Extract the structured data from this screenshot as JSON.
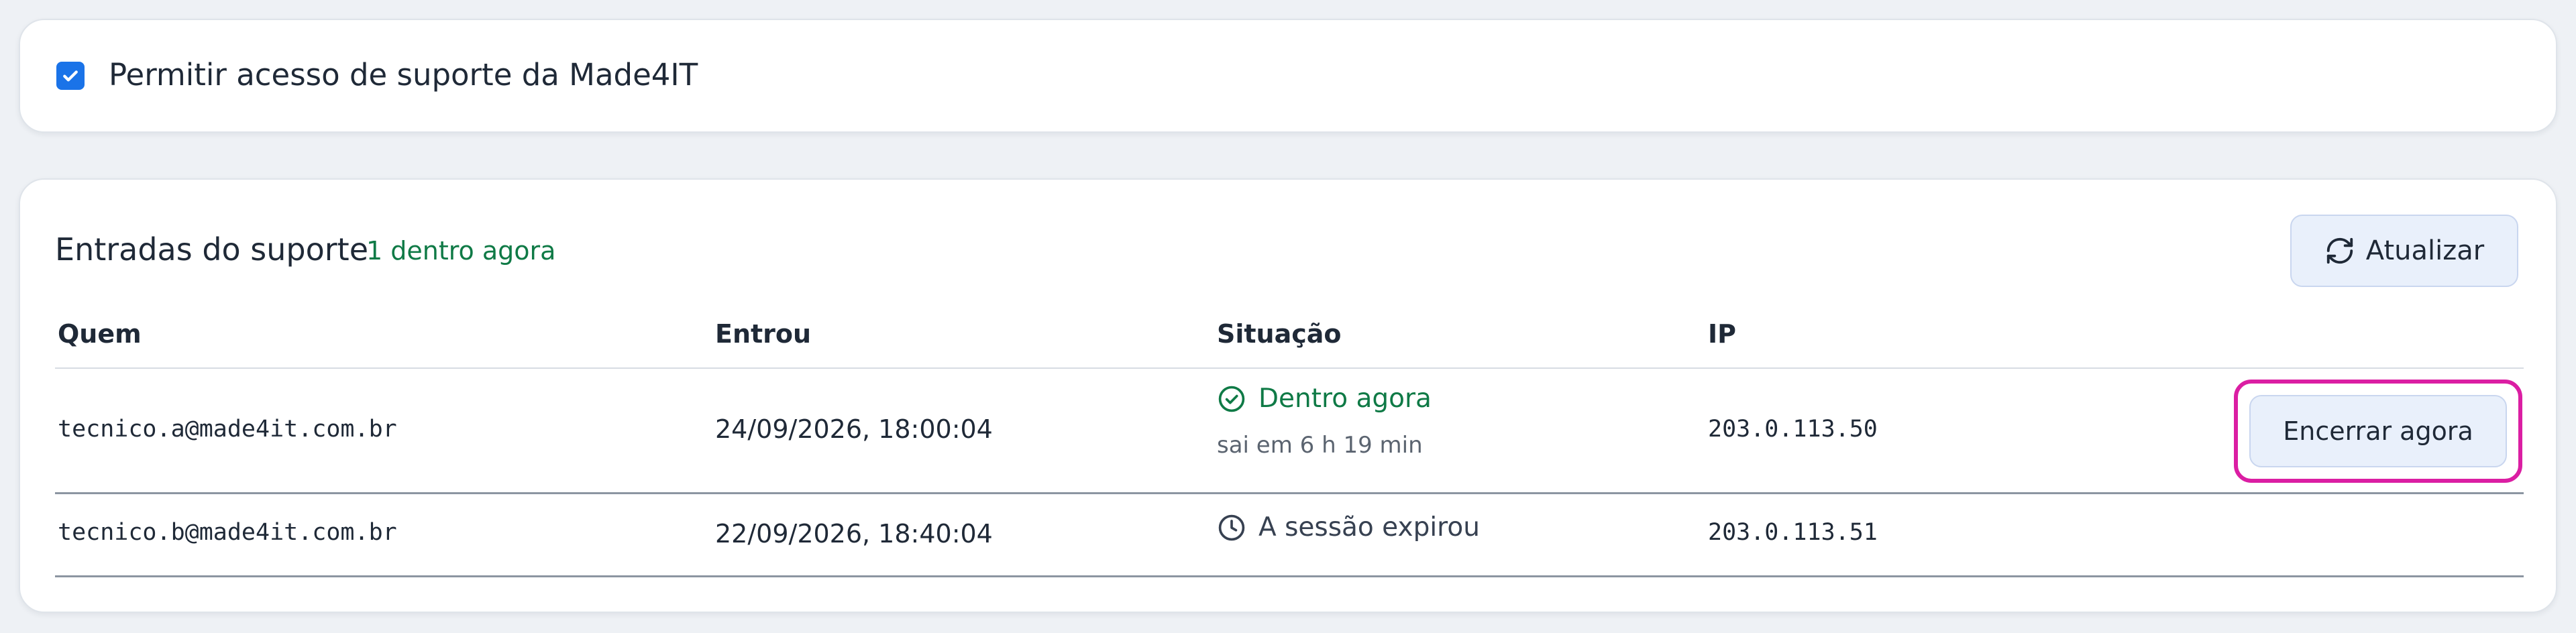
{
  "support_access": {
    "checkbox_checked": true,
    "label": "Permitir acesso de suporte da Made4IT"
  },
  "entries": {
    "title": "Entradas do suporte",
    "count_label": "1 dentro agora",
    "refresh_label": "Atualizar",
    "columns": [
      "Quem",
      "Entrou",
      "Situação",
      "IP"
    ],
    "rows": [
      {
        "who": "tecnico.a@made4it.com.br",
        "entered": "24/09/2026, 18:00:04",
        "status": "Dentro agora",
        "status_detail": "sai em 6 h 19 min",
        "status_icon": "check-circle-icon",
        "ip": "203.0.113.50",
        "action_label": "Encerrar agora"
      },
      {
        "who": "tecnico.b@made4it.com.br",
        "entered": "22/09/2026, 18:40:04",
        "status": "A sessão expirou",
        "status_icon": "clock-icon",
        "ip": "203.0.113.51"
      }
    ]
  },
  "colors": {
    "accent": "#1a73e8",
    "success": "#0f7a46",
    "highlight": "#db1ea3"
  }
}
